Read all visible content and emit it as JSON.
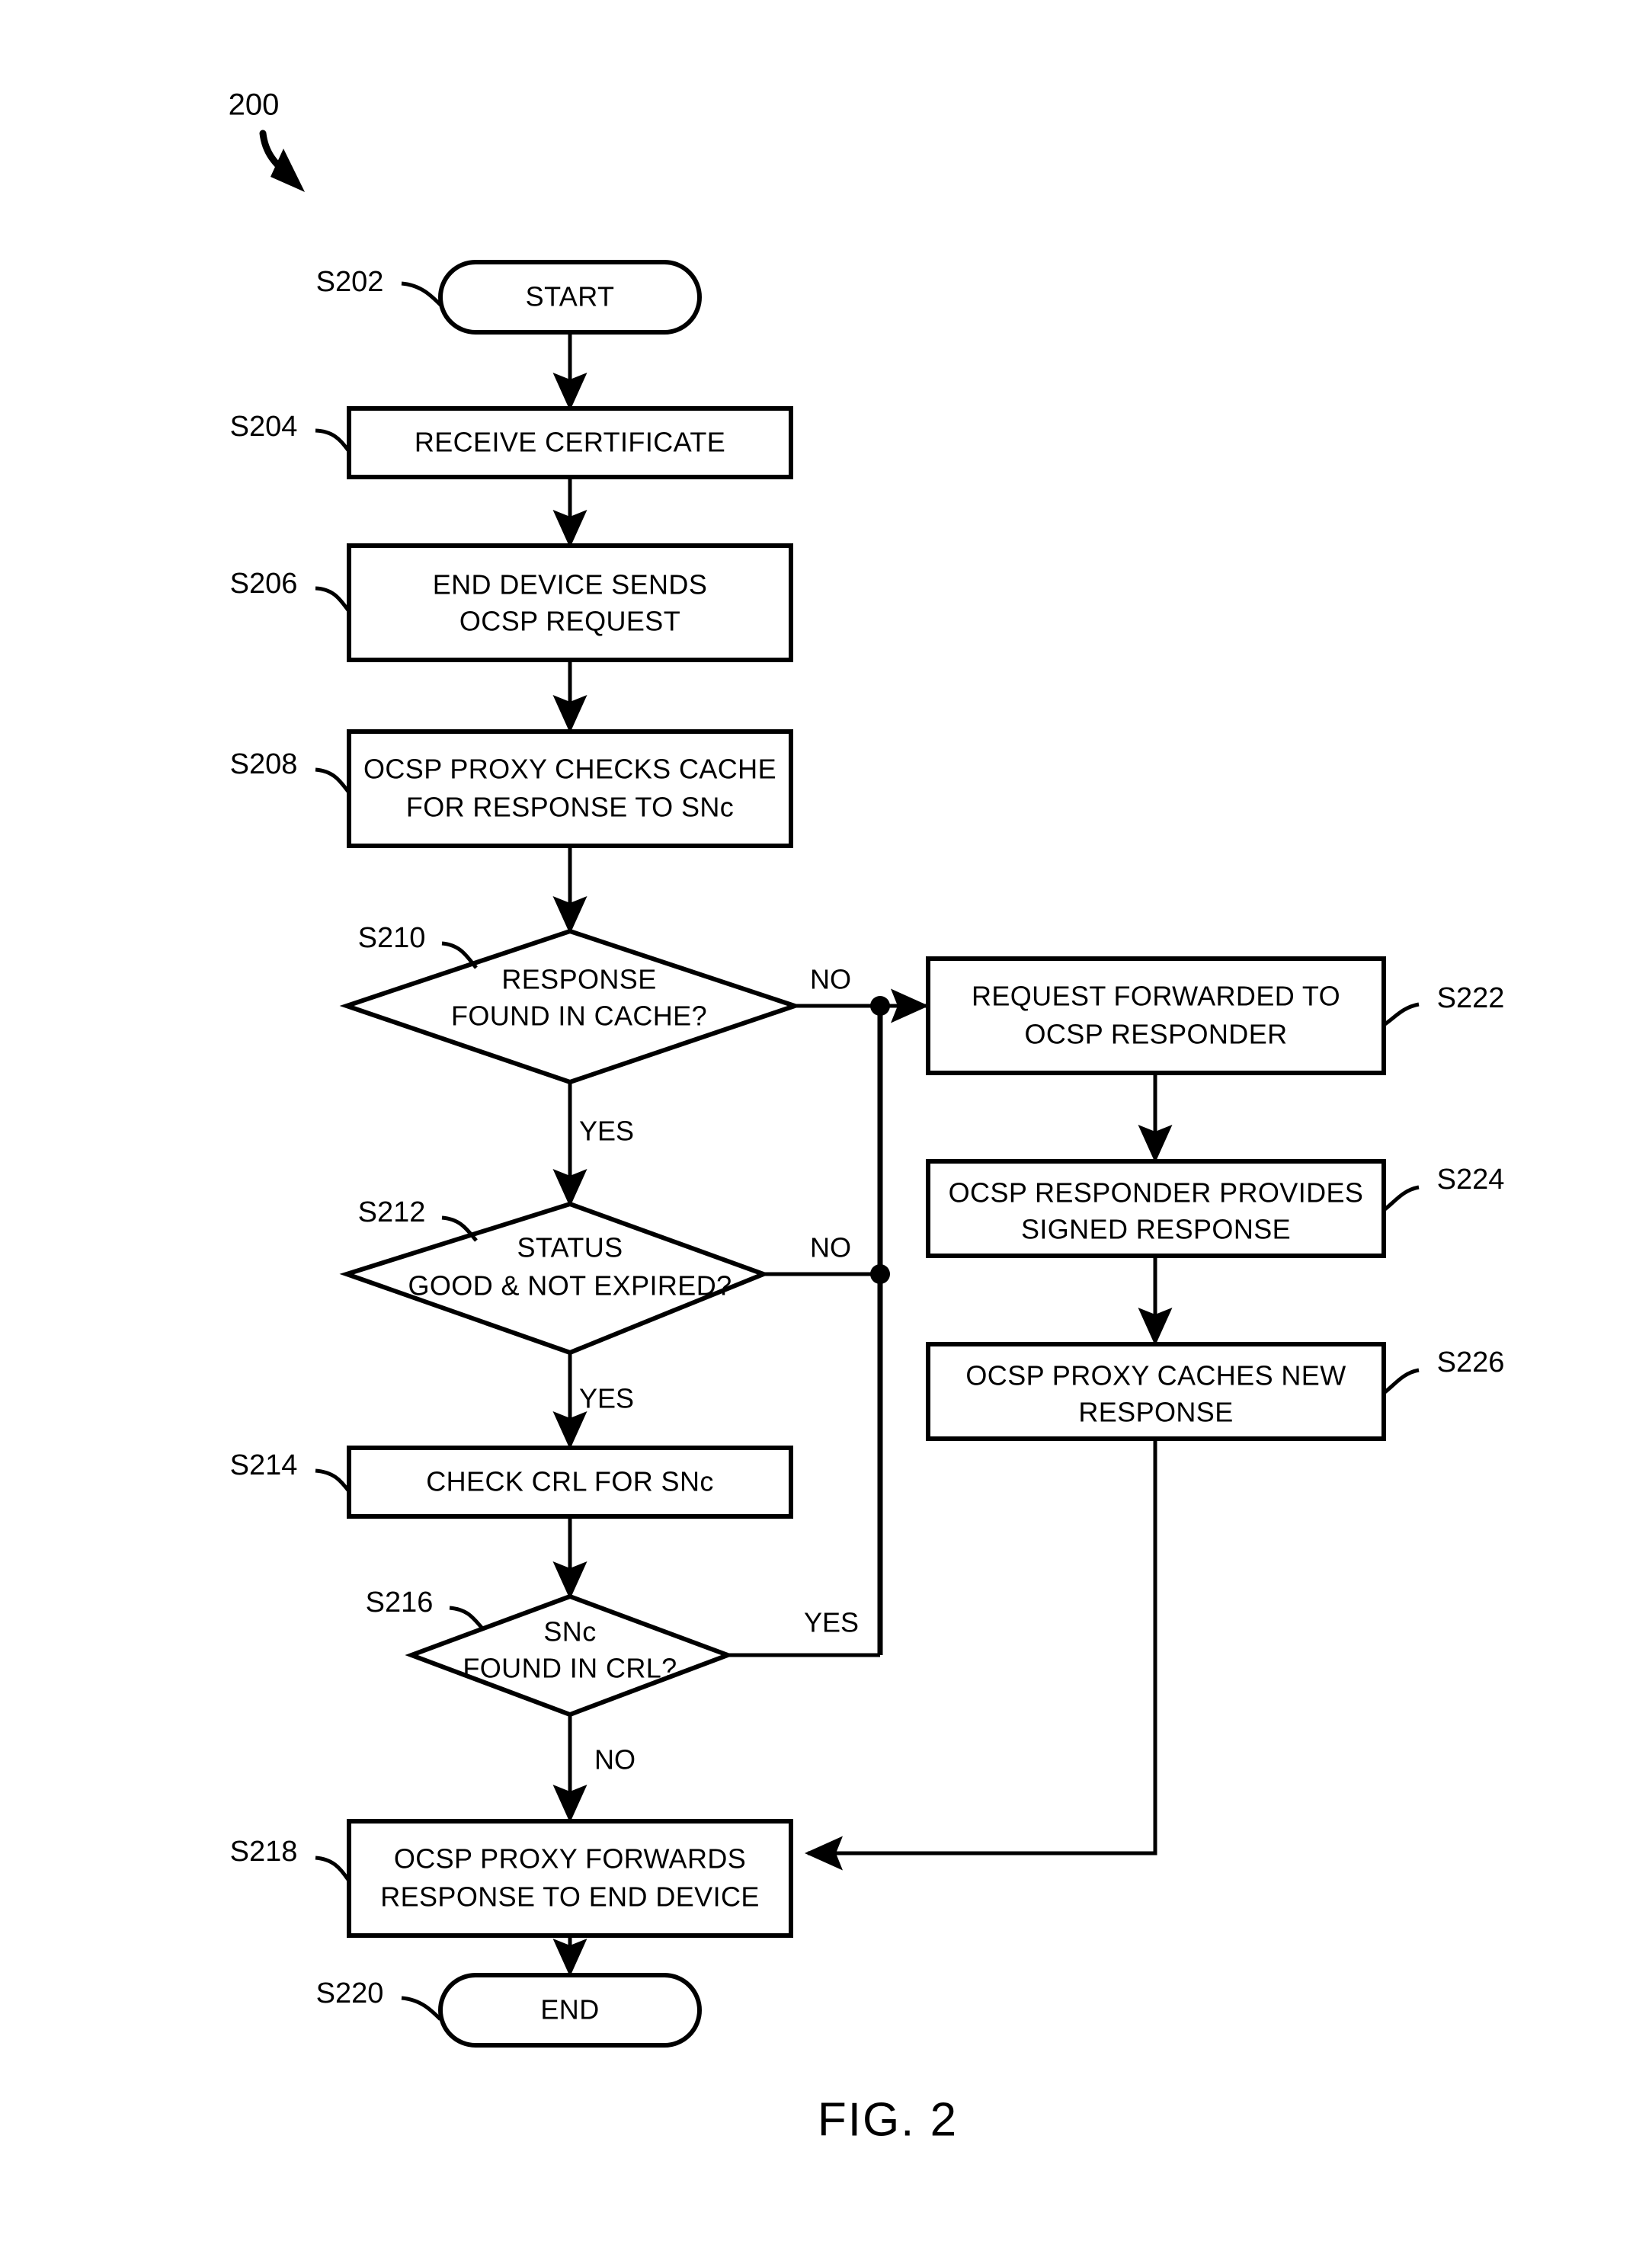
{
  "figure": {
    "caption": "FIG. 2",
    "diagram_ref": "200"
  },
  "diagram": {
    "type": "flowchart",
    "title": "OCSP proxy certificate validation flow",
    "nodes": [
      {
        "id": "S202",
        "ref": "S202",
        "shape": "terminator",
        "lines": [
          "START"
        ]
      },
      {
        "id": "S204",
        "ref": "S204",
        "shape": "process",
        "lines": [
          "RECEIVE CERTIFICATE"
        ]
      },
      {
        "id": "S206",
        "ref": "S206",
        "shape": "process",
        "lines": [
          "END DEVICE SENDS",
          "OCSP REQUEST"
        ]
      },
      {
        "id": "S208",
        "ref": "S208",
        "shape": "process",
        "lines": [
          "OCSP PROXY CHECKS CACHE",
          "FOR RESPONSE TO SNc"
        ]
      },
      {
        "id": "S210",
        "ref": "S210",
        "shape": "decision",
        "lines": [
          "RESPONSE",
          "FOUND IN CACHE?"
        ]
      },
      {
        "id": "S212",
        "ref": "S212",
        "shape": "decision",
        "lines": [
          "STATUS",
          "GOOD & NOT EXPIRED?"
        ]
      },
      {
        "id": "S214",
        "ref": "S214",
        "shape": "process",
        "lines": [
          "CHECK CRL FOR SNc"
        ]
      },
      {
        "id": "S216",
        "ref": "S216",
        "shape": "decision",
        "lines": [
          "SNc",
          "FOUND IN CRL?"
        ]
      },
      {
        "id": "S218",
        "ref": "S218",
        "shape": "process",
        "lines": [
          "OCSP PROXY FORWARDS",
          "RESPONSE TO END DEVICE"
        ]
      },
      {
        "id": "S220",
        "ref": "S220",
        "shape": "terminator",
        "lines": [
          "END"
        ]
      },
      {
        "id": "S222",
        "ref": "S222",
        "shape": "process",
        "lines": [
          "REQUEST FORWARDED TO",
          "OCSP RESPONDER"
        ]
      },
      {
        "id": "S224",
        "ref": "S224",
        "shape": "process",
        "lines": [
          "OCSP RESPONDER PROVIDES",
          "SIGNED RESPONSE"
        ]
      },
      {
        "id": "S226",
        "ref": "S226",
        "shape": "process",
        "lines": [
          "OCSP PROXY CACHES NEW",
          "RESPONSE"
        ]
      }
    ],
    "edges": [
      {
        "from": "S202",
        "to": "S204",
        "label": ""
      },
      {
        "from": "S204",
        "to": "S206",
        "label": ""
      },
      {
        "from": "S206",
        "to": "S208",
        "label": ""
      },
      {
        "from": "S208",
        "to": "S210",
        "label": ""
      },
      {
        "from": "S210",
        "to": "S222",
        "label": "NO"
      },
      {
        "from": "S210",
        "to": "S212",
        "label": "YES"
      },
      {
        "from": "S212",
        "to": "S222",
        "label": "NO"
      },
      {
        "from": "S212",
        "to": "S214",
        "label": "YES"
      },
      {
        "from": "S214",
        "to": "S216",
        "label": ""
      },
      {
        "from": "S216",
        "to": "S222",
        "label": "YES"
      },
      {
        "from": "S216",
        "to": "S218",
        "label": "NO"
      },
      {
        "from": "S222",
        "to": "S224",
        "label": ""
      },
      {
        "from": "S224",
        "to": "S226",
        "label": ""
      },
      {
        "from": "S226",
        "to": "S218",
        "label": ""
      },
      {
        "from": "S218",
        "to": "S220",
        "label": ""
      }
    ],
    "branch_labels": {
      "s210_no": "NO",
      "s210_yes": "YES",
      "s212_no": "NO",
      "s212_yes": "YES",
      "s216_yes": "YES",
      "s216_no": "NO"
    },
    "colors": {
      "stroke": "#000000",
      "fill": "#ffffff",
      "text": "#000000"
    }
  }
}
